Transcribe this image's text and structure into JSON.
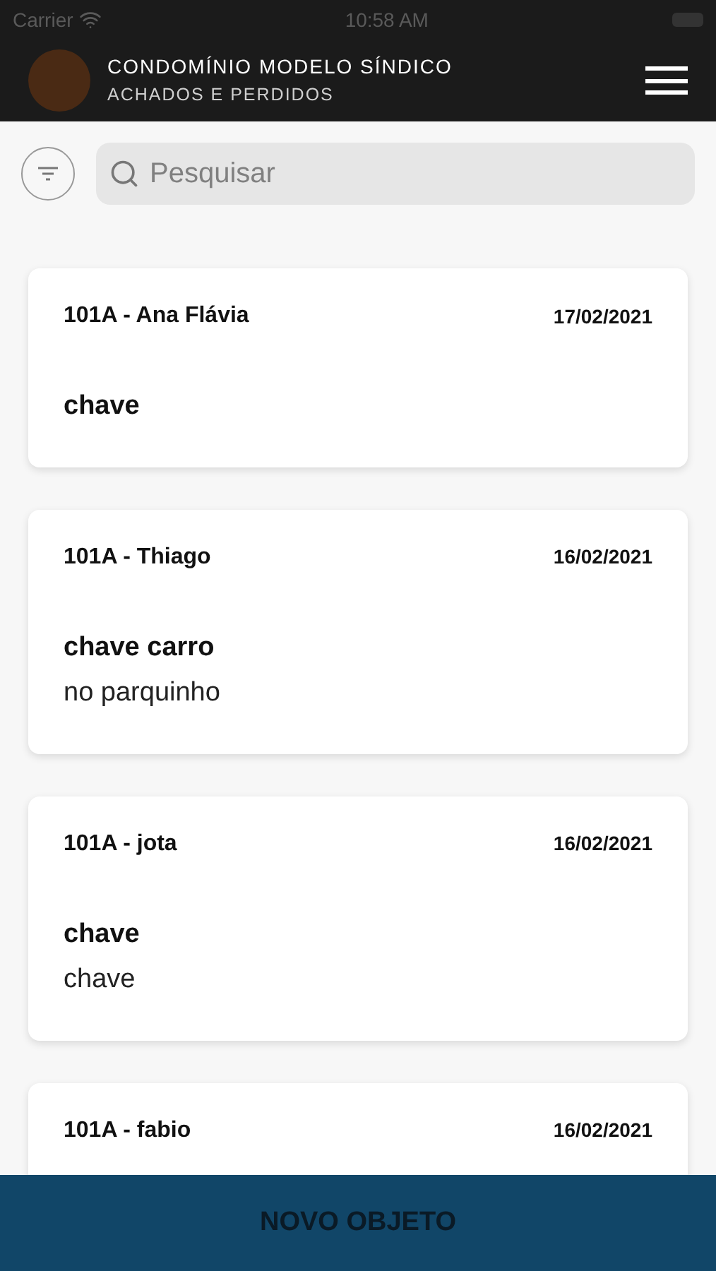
{
  "status_bar": {
    "carrier": "Carrier",
    "time": "10:58 AM"
  },
  "header": {
    "title": "CONDOMÍNIO MODELO SÍNDICO",
    "subtitle": "ACHADOS E PERDIDOS"
  },
  "search": {
    "placeholder": "Pesquisar"
  },
  "items": [
    {
      "owner": "101A - Ana Flávia",
      "date": "17/02/2021",
      "name": "chave"
    },
    {
      "owner": "101A - Thiago",
      "date": "16/02/2021",
      "name": "chave carro",
      "description": "no parquinho"
    },
    {
      "owner": "101A - jota",
      "date": "16/02/2021",
      "name": "chave",
      "description": "chave"
    },
    {
      "owner": "101A - fabio",
      "date": "16/02/2021"
    }
  ],
  "action_button": "NOVO OBJETO"
}
